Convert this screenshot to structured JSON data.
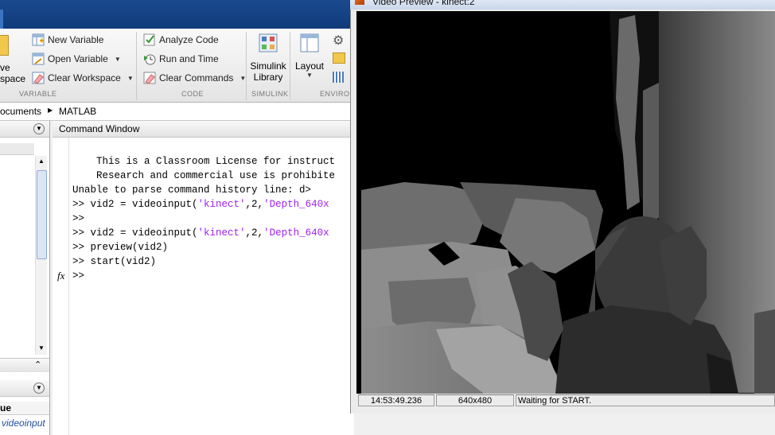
{
  "matlab": {
    "ribbon": {
      "variable_section": {
        "label": "VARIABLE",
        "save_partial": "ve",
        "workspace_partial": "space",
        "new_variable": "New Variable",
        "open_variable": "Open Variable",
        "clear_workspace": "Clear Workspace"
      },
      "code_section": {
        "label": "CODE",
        "analyze_code": "Analyze Code",
        "run_and_time": "Run and Time",
        "clear_commands": "Clear Commands"
      },
      "simulink_section": {
        "label": "SIMULINK",
        "simulink_library_line1": "Simulink",
        "simulink_library_line2": "Library"
      },
      "environment_section": {
        "label": "ENVIRO",
        "layout": "Layout"
      }
    },
    "address": {
      "path_part1": "ocuments",
      "path_part2": "MATLAB"
    },
    "workspace": {
      "value_header": "ue",
      "value_cell": "videoinput"
    },
    "command_window": {
      "title": "Command Window",
      "lines": [
        {
          "text": "    This is a Classroom License for instruct"
        },
        {
          "text": "    Research and commercial use is prohibite"
        },
        {
          "text": "Unable to parse command history line: d>"
        }
      ],
      "cmd1_prefix": ">> vid2 = videoinput(",
      "cmd1_str1": "'kinect'",
      "cmd1_mid": ",2,",
      "cmd1_str2": "'Depth_640x",
      "empty_prompt": ">>",
      "cmd2_prefix": ">> vid2 = videoinput(",
      "cmd2_str1": "'kinect'",
      "cmd2_mid": ",2,",
      "cmd2_str2": "'Depth_640x",
      "cmd3": ">> preview(vid2)",
      "cmd4": ">> start(vid2)",
      "prompt": ">>",
      "fx": "fx"
    }
  },
  "video_preview": {
    "title": "Video Preview - kinect:2",
    "status": {
      "timestamp": "14:53:49.236",
      "resolution": "640x480",
      "state": "Waiting for START."
    }
  }
}
